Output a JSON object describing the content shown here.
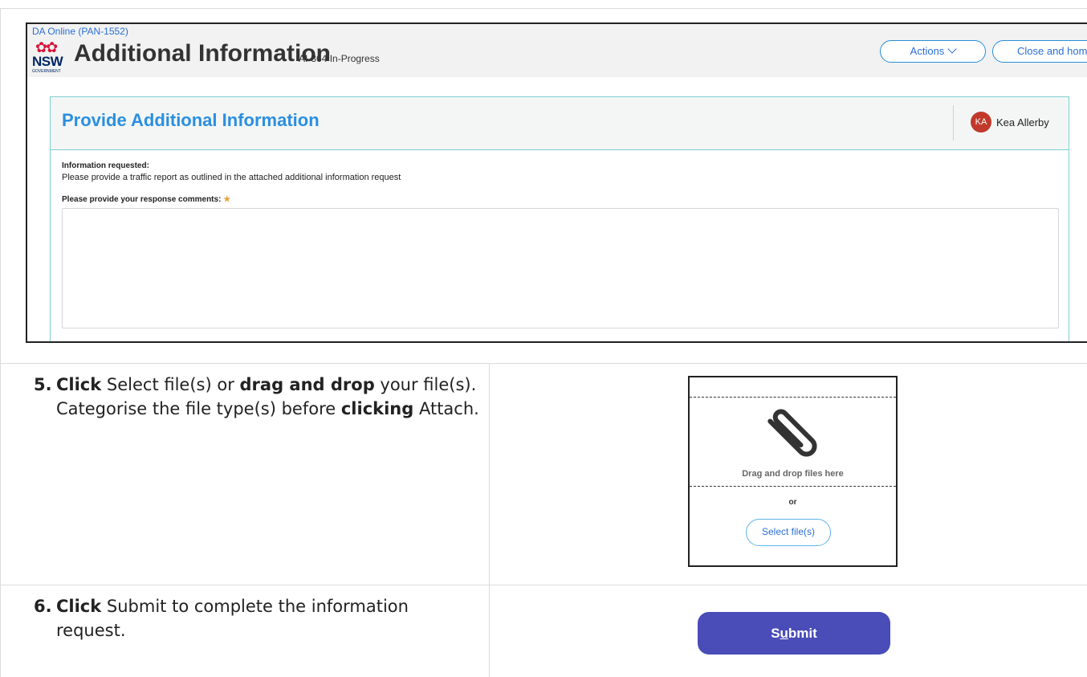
{
  "app": {
    "breadcrumb": "DA Online (PAN-1552)",
    "logo_text": "NSW",
    "logo_subtext": "GOVERNMENT",
    "title": "Additional Information",
    "subtitle": "AI-364  In-Progress",
    "actions_label": "Actions",
    "close_label": "Close and hom"
  },
  "card": {
    "title": "Provide Additional Information",
    "avatar_initials": "KA",
    "user_name": "Kea Allerby",
    "info_label": "Information requested:",
    "info_text": "Please provide a traffic report as outlined in the attached additional information request",
    "response_label": "Please provide your response comments:",
    "required_mark": "★",
    "response_value": ""
  },
  "steps": [
    {
      "number": "5.",
      "parts": [
        "Click",
        " Select file(s) or ",
        "drag and drop",
        " your file(s). Categorise the file type(s) before ",
        "clicking",
        " Attach."
      ]
    },
    {
      "number": "6.",
      "parts": [
        "Click",
        " Submit to complete the information request."
      ]
    }
  ],
  "upload": {
    "drag_text": "Drag and drop files here",
    "or_text": "or",
    "select_label": "Select file(s)"
  },
  "submit": {
    "label_pre": "S",
    "label_u": "u",
    "label_post": "bmit"
  },
  "colors": {
    "link": "#2a6fd6",
    "title_blue": "#2a8fe0",
    "card_border": "#7fcfd0",
    "avatar": "#c0392b",
    "submit": "#4a4cb8",
    "required": "#e8a33a"
  }
}
